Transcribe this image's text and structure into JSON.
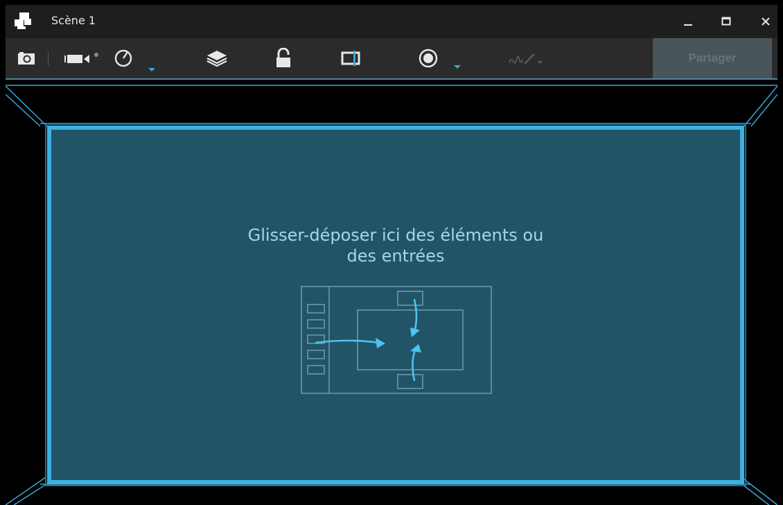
{
  "window": {
    "title": "Scène 1",
    "controls": {
      "minimize": "minimize",
      "maximize": "maximize",
      "close": "close"
    }
  },
  "toolbar": {
    "share_label": "Partager",
    "share_enabled": false,
    "buttons": [
      "snapshot-icon",
      "record-camera-icon",
      "playback-time-icon",
      "layers-icon",
      "lock-icon",
      "aspect-ratio-icon",
      "record-circle-icon",
      "signature-icon"
    ]
  },
  "drop_zone": {
    "line1": "Glisser-déposer ici des éléments ou",
    "line2": "des entrées"
  },
  "colors": {
    "accent": "#3fb0e0",
    "drop_bg": "#225468",
    "text": "#9fd8ef",
    "caret": "#3aa7d8"
  }
}
